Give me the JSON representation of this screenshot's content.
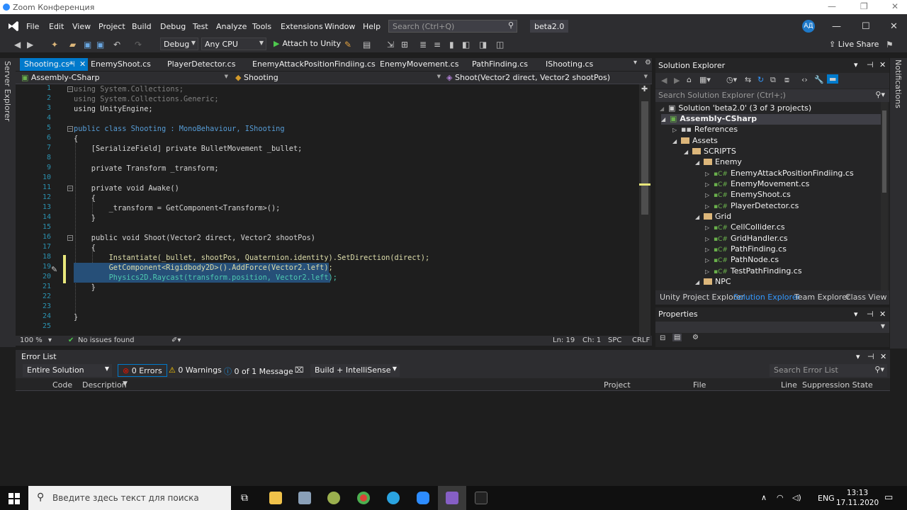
{
  "zoom": {
    "title": "Zoom Конференция"
  },
  "menu": [
    "File",
    "Edit",
    "View",
    "Project",
    "Build",
    "Debug",
    "Test",
    "Analyze",
    "Tools",
    "Extensions",
    "Window",
    "Help"
  ],
  "search": {
    "placeholder": "Search (Ctrl+Q)"
  },
  "solution_name": "beta2.0",
  "user_initials": "АД",
  "toolbar": {
    "config": "Debug",
    "platform": "Any CPU",
    "attach": "Attach to Unity",
    "live_share": "Live Share"
  },
  "left_strip": "Server Explorer",
  "right_strip": "Notifications",
  "tabs": [
    {
      "label": "Shooting.cs*",
      "active": true
    },
    {
      "label": "EnemyShoot.cs"
    },
    {
      "label": "PlayerDetector.cs"
    },
    {
      "label": "EnemyAttackPositionFindiing.cs"
    },
    {
      "label": "EnemyMovement.cs"
    },
    {
      "label": "PathFinding.cs"
    },
    {
      "label": "IShooting.cs"
    }
  ],
  "navbar": {
    "project": "Assembly-CSharp",
    "class": "Shooting",
    "member": "Shoot(Vector2 direct, Vector2 shootPos)"
  },
  "code_lines": [
    "using System.Collections;",
    "using System.Collections.Generic;",
    "using UnityEngine;",
    "",
    "public class Shooting : MonoBehaviour, IShooting",
    "{",
    "    [SerializeField] private BulletMovement _bullet;",
    "",
    "    private Transform _transform;",
    "",
    "    private void Awake()",
    "    {",
    "        _transform = GetComponent<Transform>();",
    "    }",
    "",
    "    public void Shoot(Vector2 direct, Vector2 shootPos)",
    "    {",
    "        Instantiate(_bullet, shootPos, Quaternion.identity).SetDirection(direct);",
    "        GetComponent<Rigidbody2D>().AddForce(Vector2.left);",
    "        Physics2D.Raycast(transform.position, Vector2.left);",
    "    }",
    "",
    "",
    "}",
    ""
  ],
  "editor_status": {
    "zoom": "100 %",
    "issues": "No issues found",
    "ln": "Ln: 19",
    "ch": "Ch: 1",
    "spc": "SPC",
    "crlf": "CRLF"
  },
  "solution_explorer": {
    "title": "Solution Explorer",
    "search_placeholder": "Search Solution Explorer (Ctrl+;)",
    "tree": [
      {
        "label": "Solution 'beta2.0' (3 of 3 projects)",
        "depth": 0,
        "kind": "solution"
      },
      {
        "label": "Assembly-CSharp",
        "depth": 1,
        "kind": "project",
        "selected": true
      },
      {
        "label": "References",
        "depth": 2,
        "kind": "refs"
      },
      {
        "label": "Assets",
        "depth": 2,
        "kind": "folder"
      },
      {
        "label": "SCRIPTS",
        "depth": 3,
        "kind": "folder"
      },
      {
        "label": "Enemy",
        "depth": 4,
        "kind": "folder"
      },
      {
        "label": "EnemyAttackPositionFindiing.cs",
        "depth": 5,
        "kind": "cs"
      },
      {
        "label": "EnemyMovement.cs",
        "depth": 5,
        "kind": "cs"
      },
      {
        "label": "EnemyShoot.cs",
        "depth": 5,
        "kind": "cs"
      },
      {
        "label": "PlayerDetector.cs",
        "depth": 5,
        "kind": "cs"
      },
      {
        "label": "Grid",
        "depth": 4,
        "kind": "folder"
      },
      {
        "label": "CellCollider.cs",
        "depth": 5,
        "kind": "cs"
      },
      {
        "label": "GridHandler.cs",
        "depth": 5,
        "kind": "cs"
      },
      {
        "label": "PathFinding.cs",
        "depth": 5,
        "kind": "cs"
      },
      {
        "label": "PathNode.cs",
        "depth": 5,
        "kind": "cs"
      },
      {
        "label": "TestPathFinding.cs",
        "depth": 5,
        "kind": "cs"
      },
      {
        "label": "NPC",
        "depth": 4,
        "kind": "folder"
      }
    ],
    "tabs": [
      "Unity Project Explorer",
      "Solution Explorer",
      "Team Explorer",
      "Class View"
    ]
  },
  "properties": {
    "title": "Properties"
  },
  "error_list": {
    "title": "Error List",
    "scope": "Entire Solution",
    "errors": "0 Errors",
    "warnings": "0 Warnings",
    "messages": "0 of 1 Message",
    "build_filter": "Build + IntelliSense",
    "search_placeholder": "Search Error List",
    "columns": [
      "Code",
      "Description",
      "Project",
      "File",
      "Line",
      "Suppression State"
    ]
  },
  "taskbar": {
    "search_placeholder": "Введите здесь текст для поиска",
    "lang": "ENG",
    "time": "13:13",
    "date": "17.11.2020"
  }
}
